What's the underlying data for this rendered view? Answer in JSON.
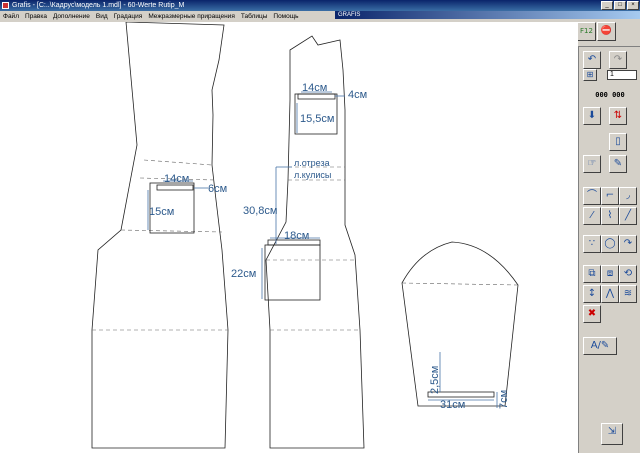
{
  "window": {
    "title": "Grafis - [C:..\\Кадрус\\модель 1.mdl] - 60-Werte Rutip_M"
  },
  "menu": {
    "items": [
      "Файл",
      "Правка",
      "Дополнение",
      "Вид",
      "Градация",
      "Межразмерные приращения",
      "Таблицы",
      "Помощь"
    ]
  },
  "toolbar": {
    "title": "GRAFIS",
    "buttons": [
      {
        "icon": "open-folder-icon",
        "glyph": "📂"
      },
      {
        "icon": "save-icon",
        "glyph": "💾"
      },
      {
        "icon": "print-icon",
        "glyph": "⎙"
      },
      {
        "icon": "zoom-icon",
        "glyph": "🔍"
      },
      {
        "icon": "f6-icon",
        "glyph": "F6"
      },
      {
        "icon": "export-icon",
        "glyph": "⇱"
      },
      {
        "icon": "measure-icon",
        "glyph": "▭"
      },
      {
        "icon": "download-icon",
        "glyph": "⬇"
      },
      {
        "icon": "stack-down-icon",
        "glyph": "⤓"
      },
      {
        "icon": "page-icon",
        "glyph": "▤"
      },
      {
        "icon": "close-doc-icon",
        "glyph": "✕"
      },
      {
        "icon": "f11-icon",
        "glyph": "F11"
      },
      {
        "icon": "f12-icon",
        "glyph": "F12"
      },
      {
        "icon": "stop-icon",
        "glyph": "⛔"
      }
    ]
  },
  "side": {
    "counter": "000 000",
    "number": "1"
  },
  "pattern": {
    "labels": {
      "front_pocket_width": "14см",
      "front_pocket_offset": "6см",
      "front_pocket_depth": "15см",
      "chest_pocket_width": "14см",
      "chest_pocket_offset": "4см",
      "chest_pocket_depth": "15,5см",
      "yoke_line": "л.отреза",
      "drawstring_line": "л.кулисы",
      "side_pocket_offset": "30,8см",
      "side_pocket_width": "18см",
      "side_pocket_depth": "22см",
      "sleeve_hem_height": "2,5см",
      "sleeve_cuff_width": "31см",
      "sleeve_cuff_height": "7см"
    }
  }
}
